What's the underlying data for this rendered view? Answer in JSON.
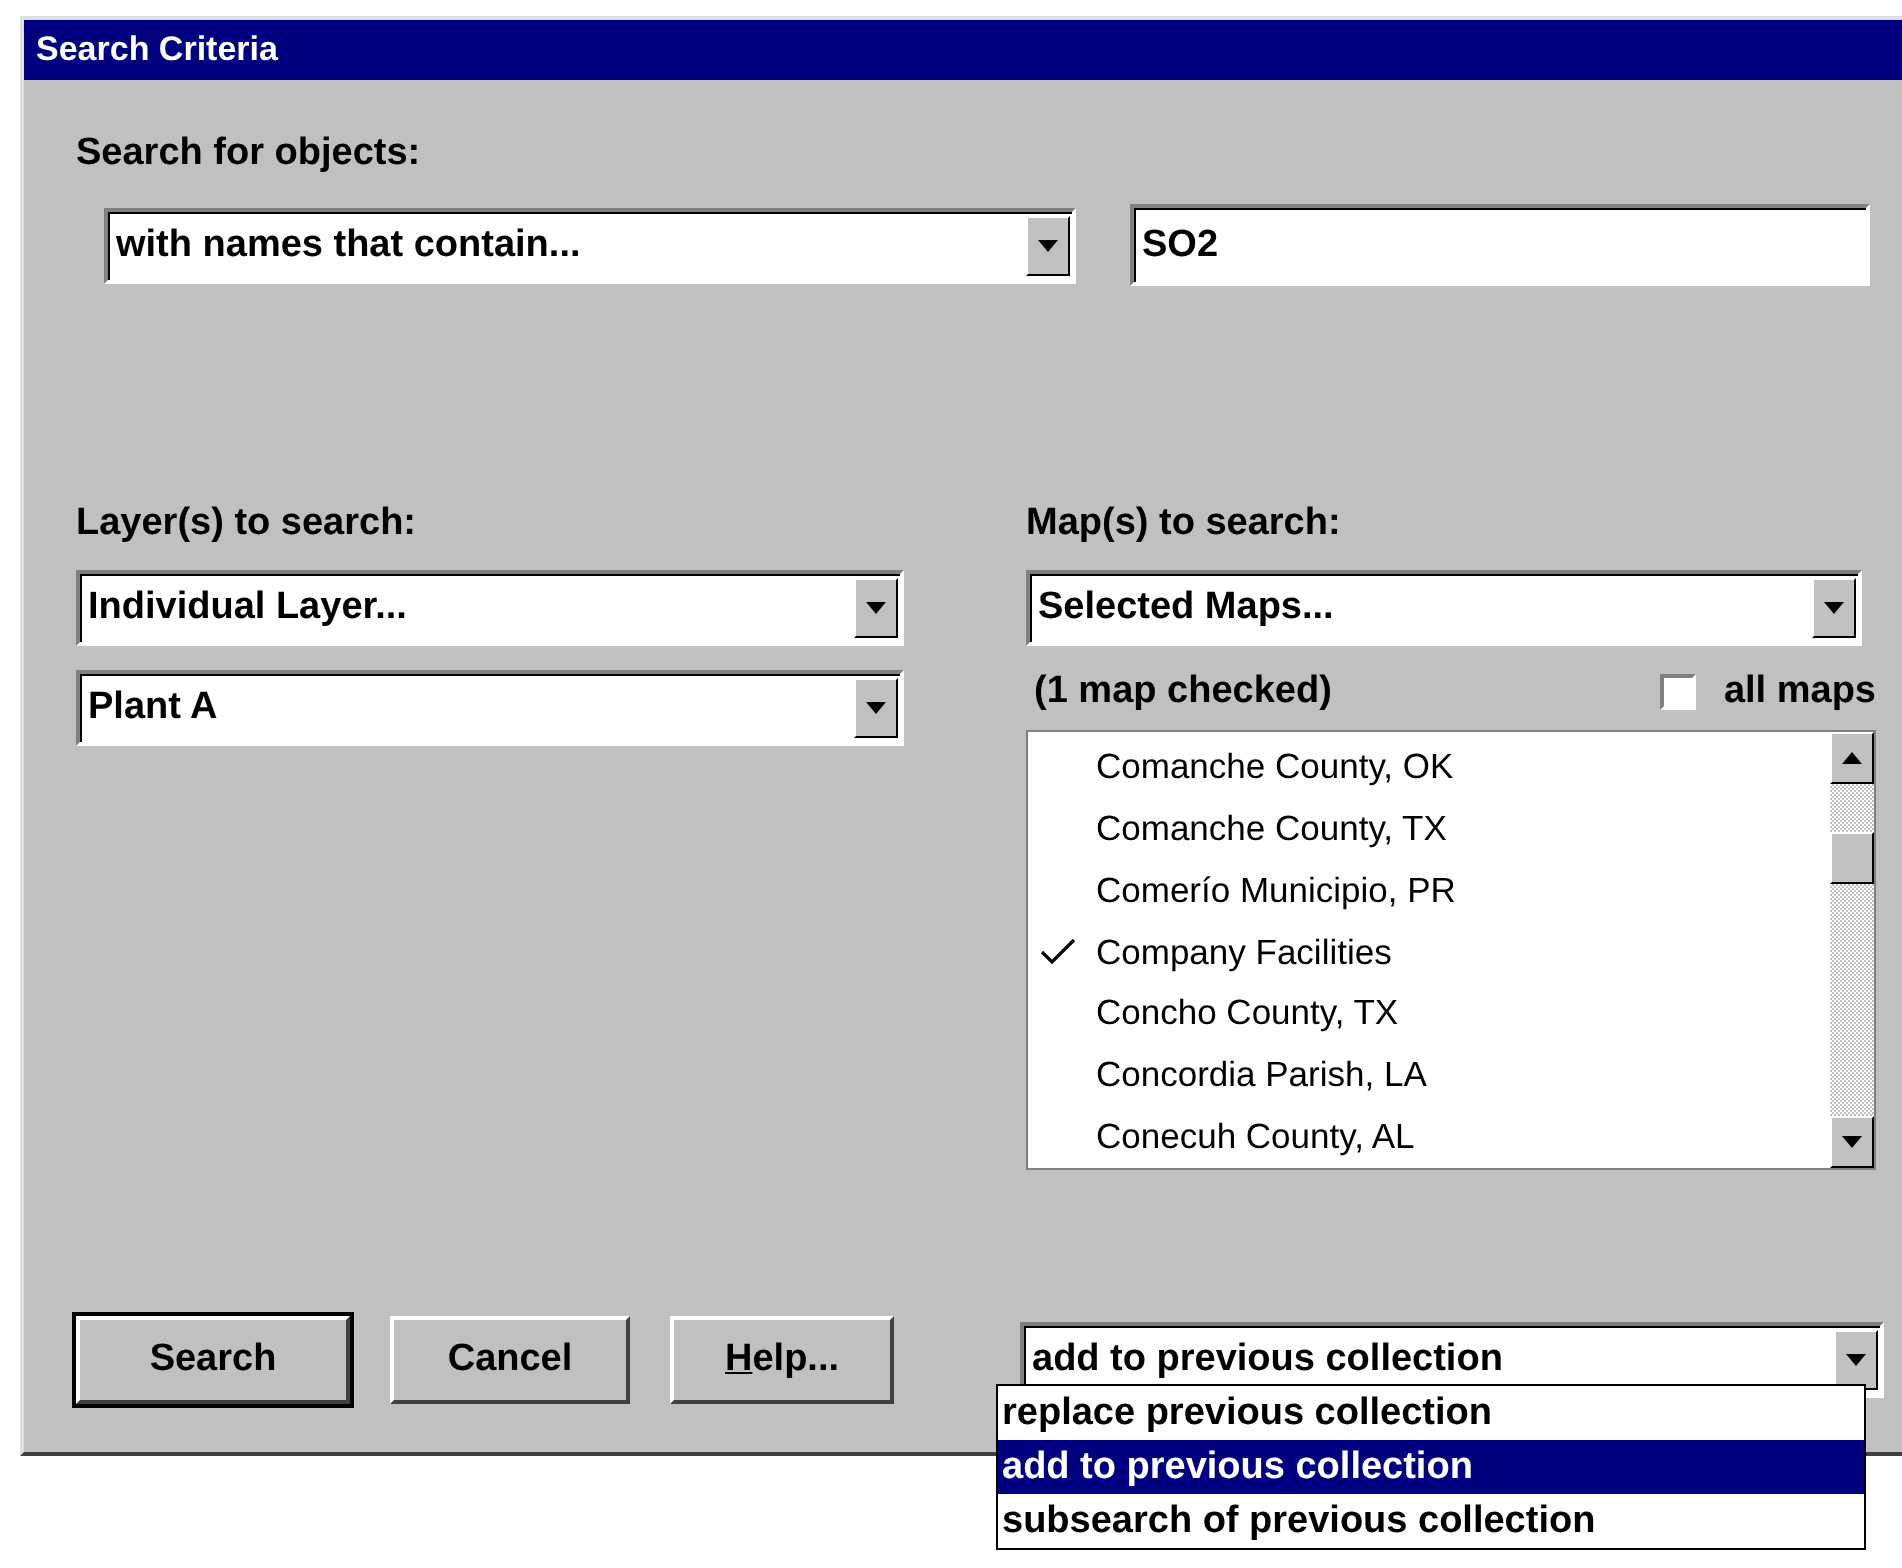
{
  "window": {
    "title": "Search Criteria"
  },
  "search_for": {
    "label": "Search for objects:",
    "mode": "with names that contain...",
    "text": "SO2"
  },
  "layers": {
    "label": "Layer(s) to search:",
    "scope": "Individual Layer...",
    "layer": "Plant A"
  },
  "maps": {
    "label": "Map(s) to search:",
    "scope": "Selected Maps...",
    "count": "(1 map checked)",
    "all_maps": {
      "label": "all maps",
      "checked": false
    },
    "items": [
      {
        "name": "Comanche County, OK",
        "checked": false
      },
      {
        "name": "Comanche County, TX",
        "checked": false
      },
      {
        "name": "Comerío Municipio, PR",
        "checked": false
      },
      {
        "name": "Company Facilities",
        "checked": true
      },
      {
        "name": "Concho County, TX",
        "checked": false
      },
      {
        "name": "Concordia Parish, LA",
        "checked": false
      },
      {
        "name": "Conecuh County, AL",
        "checked": false
      }
    ]
  },
  "buttons": [
    {
      "label": "Search",
      "default": true,
      "underline_first": false
    },
    {
      "label": "Cancel",
      "default": false,
      "underline_first": false
    },
    {
      "label": "Help...",
      "default": false,
      "underline_first": true
    }
  ],
  "collection": {
    "value": "add to previous collection",
    "expanded": true,
    "options": [
      {
        "label": "replace previous collection",
        "selected": false
      },
      {
        "label": "add to previous collection",
        "selected": true
      },
      {
        "label": "subsearch of previous collection",
        "selected": false
      }
    ]
  }
}
